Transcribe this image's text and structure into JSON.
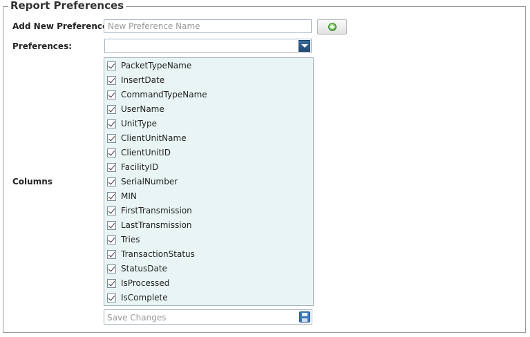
{
  "form": {
    "legend": "Report Preferences",
    "add_label": "Add New Preference:",
    "add_placeholder": "New Preference Name",
    "add_value": "",
    "preferences_label": "Preferences:",
    "preferences_selected": "",
    "columns_label": "Columns",
    "save_placeholder": "Save Changes"
  },
  "icons": {
    "add": "plus-circle-icon",
    "dropdown": "chevron-down-icon",
    "save": "floppy-disk-icon"
  },
  "colors": {
    "list_background": "#e9f5f5",
    "dropdown_arrow": "#2a5a87",
    "add_icon": "#3f9a2c",
    "save_icon": "#3a78c2"
  },
  "columns": [
    {
      "label": "PacketTypeName",
      "checked": true
    },
    {
      "label": "InsertDate",
      "checked": true
    },
    {
      "label": "CommandTypeName",
      "checked": true
    },
    {
      "label": "UserName",
      "checked": true
    },
    {
      "label": "UnitType",
      "checked": true
    },
    {
      "label": "ClientUnitName",
      "checked": true
    },
    {
      "label": "ClientUnitID",
      "checked": true
    },
    {
      "label": "FacilityID",
      "checked": true
    },
    {
      "label": "SerialNumber",
      "checked": true
    },
    {
      "label": "MIN",
      "checked": true
    },
    {
      "label": "FirstTransmission",
      "checked": true
    },
    {
      "label": "LastTransmission",
      "checked": true
    },
    {
      "label": "Tries",
      "checked": true
    },
    {
      "label": "TransactionStatus",
      "checked": true
    },
    {
      "label": "StatusDate",
      "checked": true
    },
    {
      "label": "IsProcessed",
      "checked": true
    },
    {
      "label": "IsComplete",
      "checked": true
    }
  ]
}
